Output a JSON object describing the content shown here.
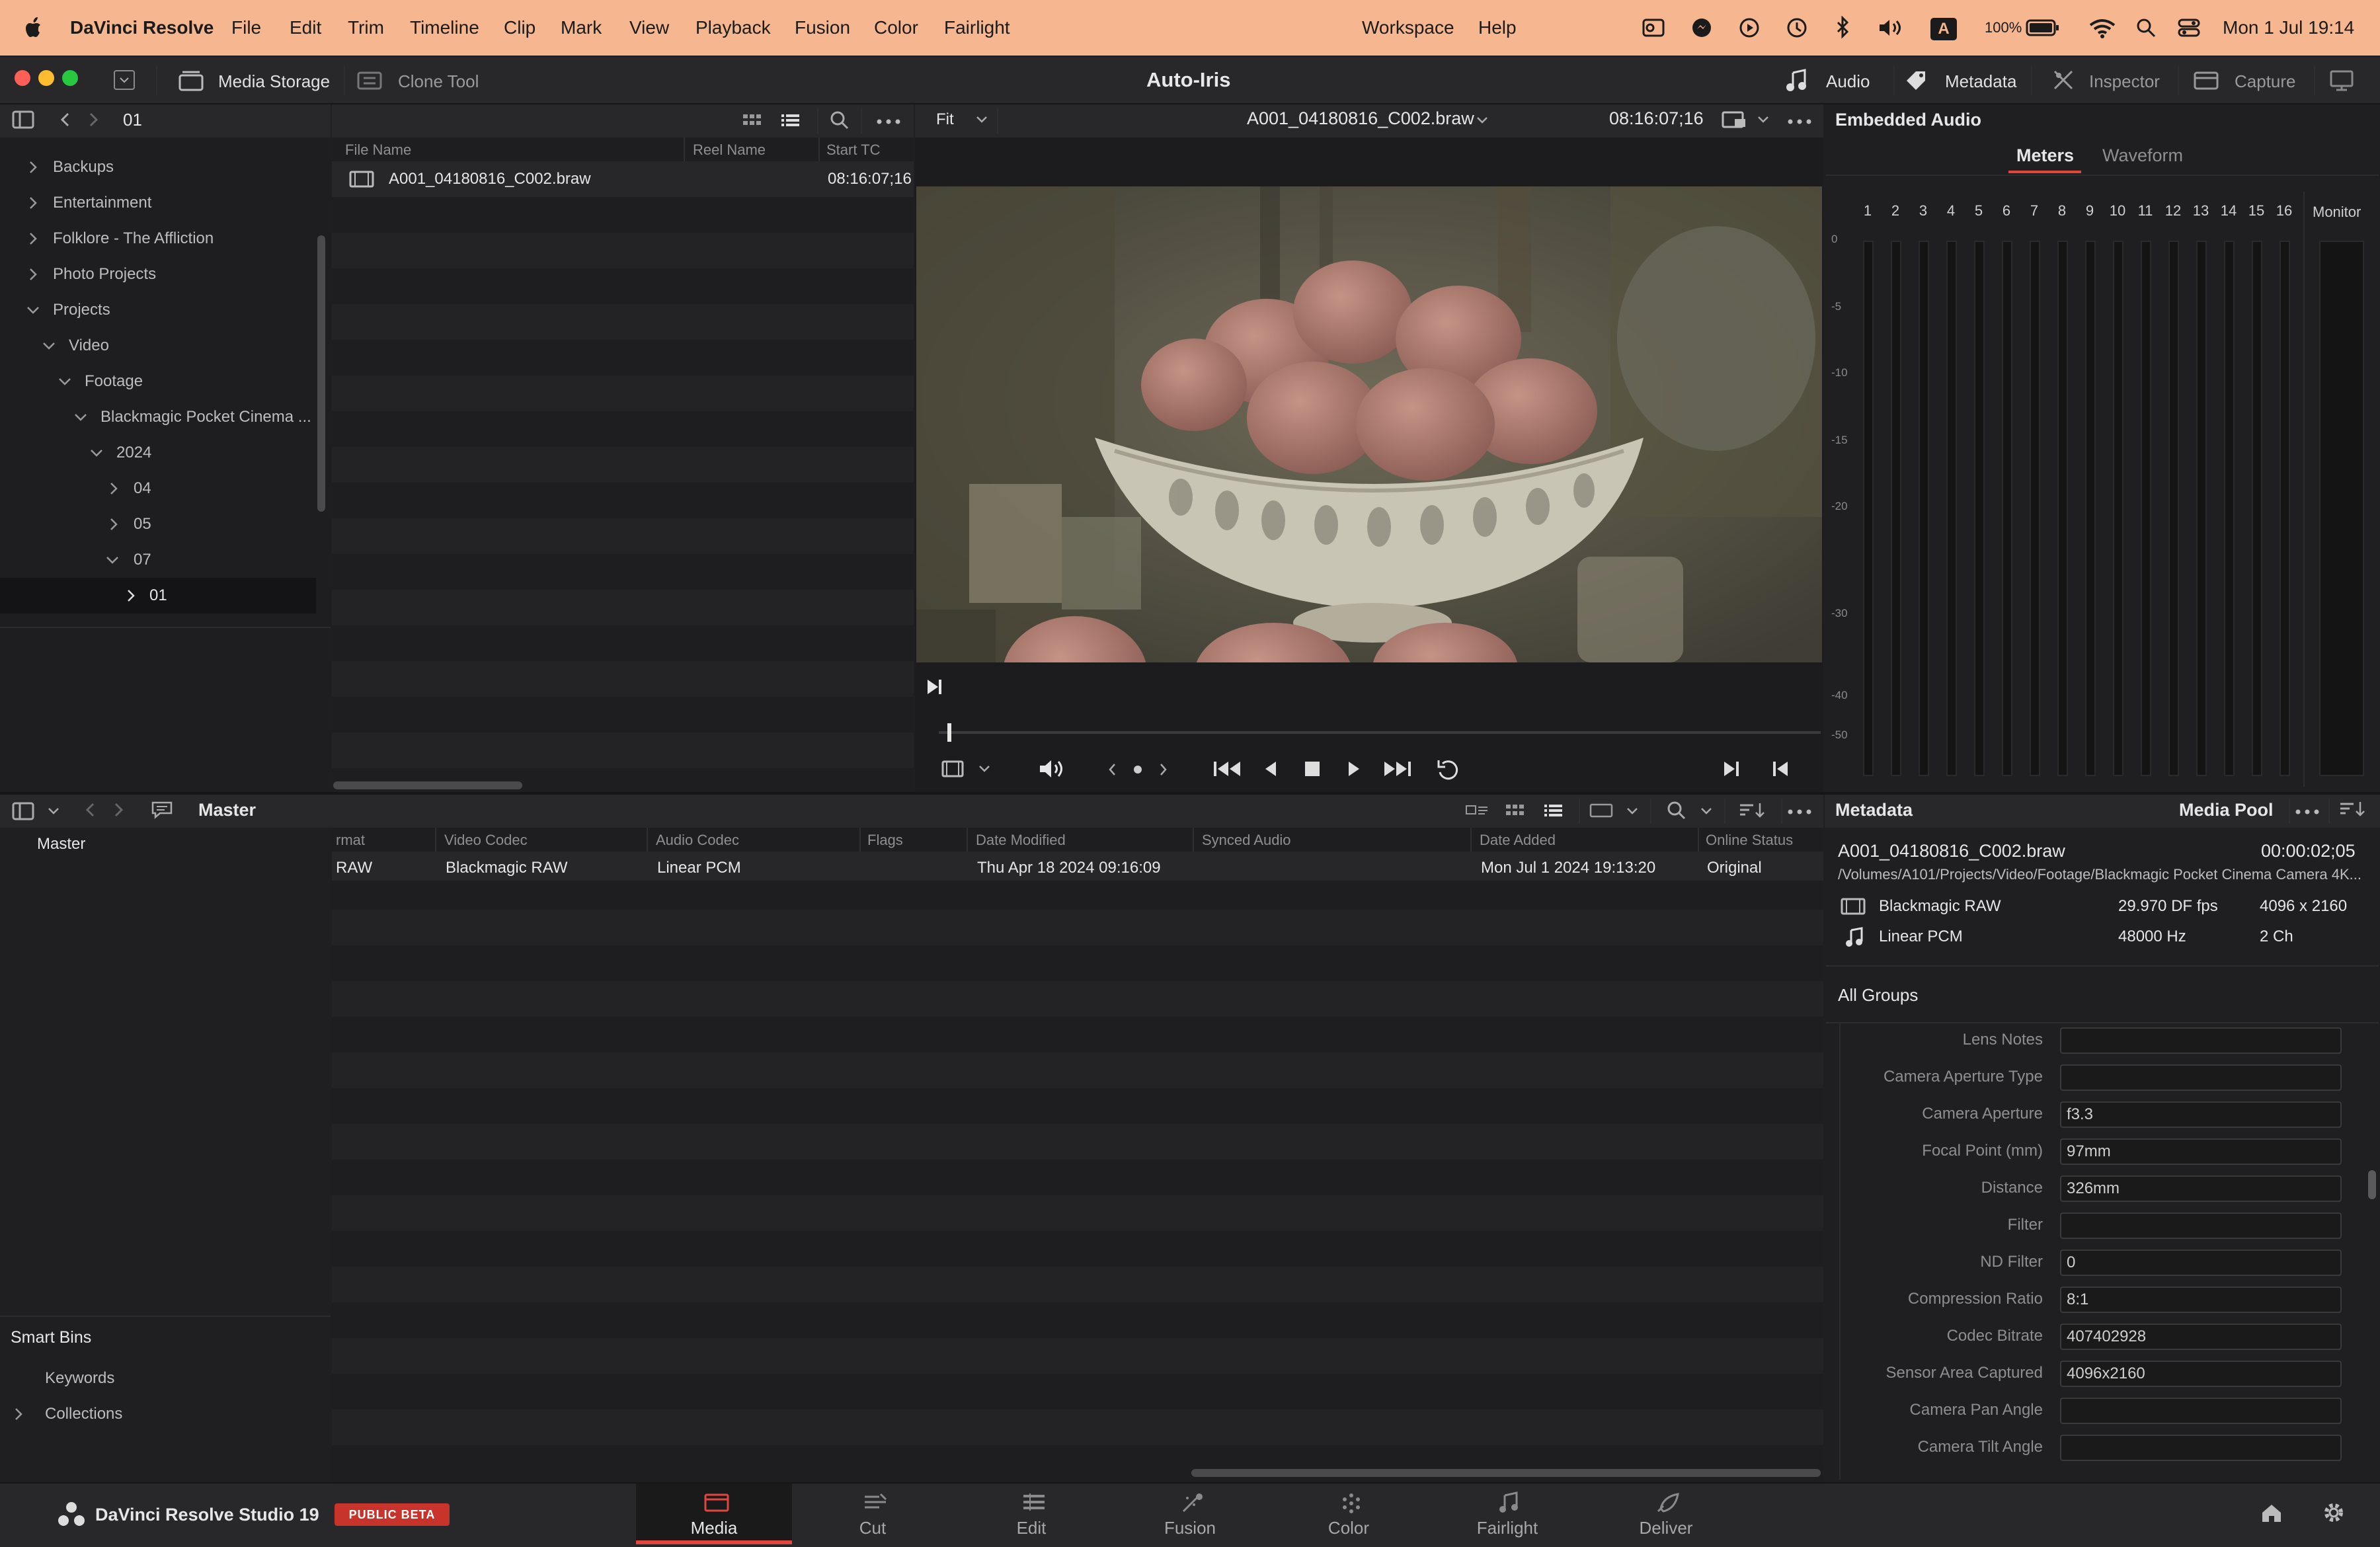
{
  "menubar": {
    "app": "DaVinci Resolve",
    "items": [
      "File",
      "Edit",
      "Trim",
      "Timeline",
      "Clip",
      "Mark",
      "View",
      "Playback",
      "Fusion",
      "Color",
      "Fairlight"
    ],
    "right_items": [
      "Workspace",
      "Help"
    ],
    "battery": "100%",
    "input_source": "A",
    "clock": "Mon 1 Jul  19:14"
  },
  "toolbar": {
    "media_storage": "Media Storage",
    "clone_tool": "Clone Tool",
    "title": "Auto-Iris",
    "audio": "Audio",
    "metadata": "Metadata",
    "inspector": "Inspector",
    "capture": "Capture"
  },
  "storage": {
    "path_label": "01",
    "tree": [
      {
        "label": "Backups"
      },
      {
        "label": "Entertainment"
      },
      {
        "label": "Folklore - The Affliction"
      },
      {
        "label": "Photo Projects"
      },
      {
        "label": "Projects"
      },
      {
        "label": "Video"
      },
      {
        "label": "Footage"
      },
      {
        "label": "Blackmagic Pocket Cinema ..."
      },
      {
        "label": "2024"
      },
      {
        "label": "04"
      },
      {
        "label": "05"
      },
      {
        "label": "07"
      },
      {
        "label": "01"
      }
    ]
  },
  "files": {
    "col_name": "File Name",
    "col_reel": "Reel Name",
    "col_tc": "Start TC",
    "row": {
      "name": "A001_04180816_C002.braw",
      "tc": "08:16:07;16"
    }
  },
  "viewer": {
    "zoom": "Fit",
    "clip_name": "A001_04180816_C002.braw",
    "timecode": "08:16:07;16",
    "playhead_fraction": 0.01
  },
  "audio_panel": {
    "title": "Embedded Audio",
    "tab_meters": "Meters",
    "tab_waveform": "Waveform",
    "channels": [
      "1",
      "2",
      "3",
      "4",
      "5",
      "6",
      "7",
      "8",
      "9",
      "10",
      "11",
      "12",
      "13",
      "14",
      "15",
      "16"
    ],
    "monitor": "Monitor",
    "db_scale": [
      "0",
      "-5",
      "-10",
      "-15",
      "-20",
      "-30",
      "-40",
      "-50"
    ]
  },
  "pool": {
    "title": "Master",
    "bins": [
      "Master"
    ],
    "smart_bins_title": "Smart Bins",
    "smart_bins": [
      "Keywords",
      "Collections"
    ],
    "columns": [
      "rmat",
      "Video Codec",
      "Audio Codec",
      "Flags",
      "Date Modified",
      "Synced Audio",
      "Date Added",
      "Online Status"
    ],
    "row": [
      "RAW",
      "Blackmagic RAW",
      "Linear PCM",
      "",
      "Thu Apr 18 2024 09:16:09",
      "",
      "Mon Jul 1 2024 19:13:20",
      "Original"
    ]
  },
  "metadata": {
    "title": "Metadata",
    "source": "Media Pool",
    "clip_name": "A001_04180816_C002.braw",
    "duration": "00:00:02;05",
    "path": "/Volumes/A101/Projects/Video/Footage/Blackmagic Pocket Cinema Camera 4K...",
    "video_codec": "Blackmagic RAW",
    "fps": "29.970 DF fps",
    "resolution": "4096 x 2160",
    "audio_codec": "Linear PCM",
    "sample_rate": "48000 Hz",
    "channels": "2 Ch",
    "groups": "All Groups",
    "fields": [
      {
        "label": "Lens Notes",
        "value": ""
      },
      {
        "label": "Camera Aperture Type",
        "value": ""
      },
      {
        "label": "Camera Aperture",
        "value": "f3.3"
      },
      {
        "label": "Focal Point (mm)",
        "value": "97mm"
      },
      {
        "label": "Distance",
        "value": "326mm"
      },
      {
        "label": "Filter",
        "value": ""
      },
      {
        "label": "ND Filter",
        "value": "0"
      },
      {
        "label": "Compression Ratio",
        "value": "8:1"
      },
      {
        "label": "Codec Bitrate",
        "value": "407402928"
      },
      {
        "label": "Sensor Area Captured",
        "value": "4096x2160"
      },
      {
        "label": "Camera Pan Angle",
        "value": ""
      },
      {
        "label": "Camera Tilt Angle",
        "value": ""
      }
    ]
  },
  "bottom": {
    "brand": "DaVinci Resolve Studio 19",
    "beta": "PUBLIC BETA",
    "pages": [
      "Media",
      "Cut",
      "Edit",
      "Fusion",
      "Color",
      "Fairlight",
      "Deliver"
    ],
    "active_page": "Media"
  },
  "colors": {
    "menubar": "#f6b68f",
    "accent_red": "#e0463c",
    "beta_red": "#c8332b",
    "panel": "#1e1e20"
  }
}
